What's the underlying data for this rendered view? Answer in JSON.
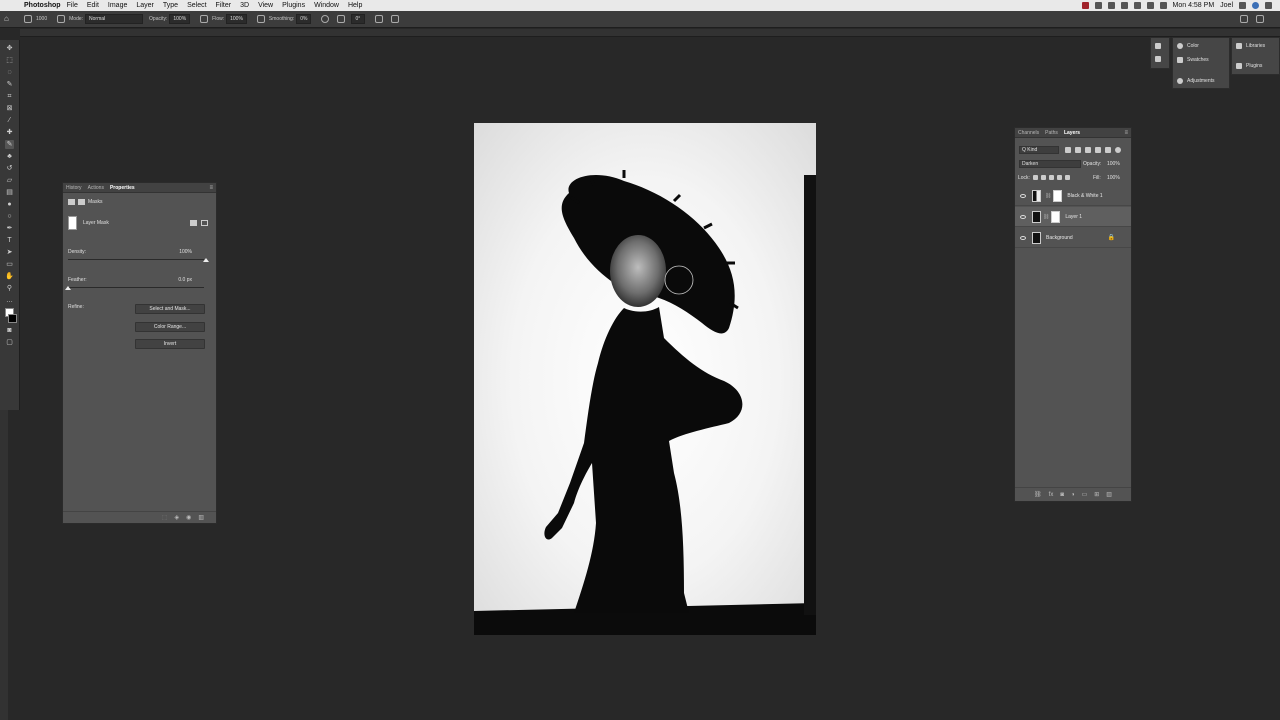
{
  "menubar": {
    "app": "Photoshop",
    "items": [
      "File",
      "Edit",
      "Image",
      "Layer",
      "Type",
      "Select",
      "Filter",
      "3D",
      "View",
      "Plugins",
      "Window",
      "Help"
    ],
    "clock": "Mon 4:58 PM",
    "user": "Joel"
  },
  "options": {
    "brush_size": "1000",
    "mode_label": "Mode:",
    "mode_value": "Normal",
    "opacity_label": "Opacity:",
    "opacity_value": "100%",
    "flow_label": "Flow:",
    "flow_value": "100%",
    "smoothing_label": "Smoothing:",
    "smoothing_value": "0%",
    "angle_value": "0°"
  },
  "properties_panel": {
    "tabs": [
      "History",
      "Actions",
      "Properties"
    ],
    "active_tab": "Properties",
    "section": "Masks",
    "mask_label": "Layer Mask",
    "density_label": "Density:",
    "density_value": "100%",
    "density_level": 1.0,
    "feather_label": "Feather:",
    "feather_value": "0.0 px",
    "feather_level": 0.0,
    "refine_label": "Refine:",
    "buttons": [
      "Select and Mask...",
      "Color Range...",
      "Invert"
    ]
  },
  "layers_panel": {
    "tabs": [
      "Channels",
      "Paths",
      "Layers"
    ],
    "active_tab": "Layers",
    "filter_label": "Q Kind",
    "blend_mode": "Darken",
    "opacity_label": "Opacity:",
    "opacity_value": "100%",
    "lock_label": "Lock:",
    "fill_label": "Fill:",
    "fill_value": "100%",
    "layers": [
      {
        "name": "Black & White 1",
        "type": "adjustment",
        "selected": false
      },
      {
        "name": "Layer 1",
        "type": "masked",
        "selected": true
      },
      {
        "name": "Background",
        "type": "background",
        "selected": false
      }
    ]
  },
  "dock": {
    "items_col1": [
      "Color",
      "Swatches",
      "Adjustments"
    ],
    "items_col2": [
      "Libraries",
      "Plugins"
    ]
  }
}
